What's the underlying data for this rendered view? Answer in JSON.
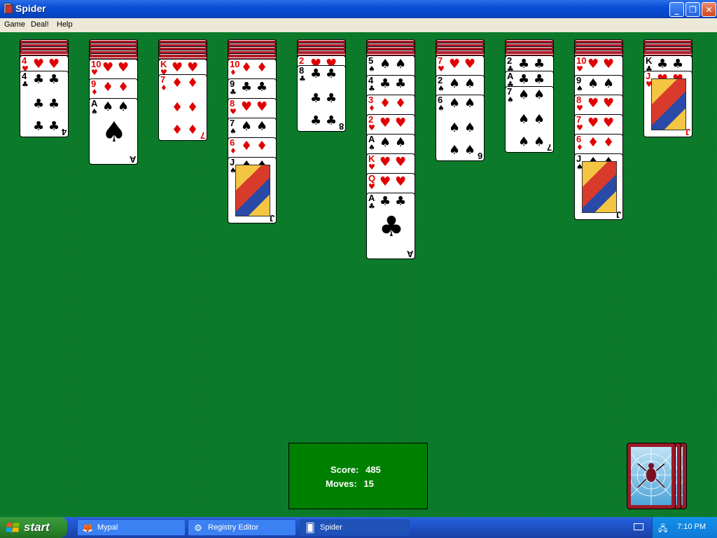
{
  "window": {
    "title": "Spider"
  },
  "menu": [
    "Game",
    "Deal!",
    "Help"
  ],
  "status": {
    "score_label": "Score:",
    "score": "485",
    "moves_label": "Moves:",
    "moves": "15"
  },
  "columns": [
    {
      "hidden": 4,
      "cards": [
        {
          "rank": "4",
          "suit": "♥"
        },
        {
          "rank": "4",
          "suit": "♣"
        }
      ]
    },
    {
      "hidden": 5,
      "cards": [
        {
          "rank": "10",
          "suit": "♥"
        },
        {
          "rank": "9",
          "suit": "♦"
        },
        {
          "rank": "A",
          "suit": "♠"
        }
      ]
    },
    {
      "hidden": 5,
      "cards": [
        {
          "rank": "K",
          "suit": "♥"
        },
        {
          "rank": "7",
          "suit": "♦"
        }
      ]
    },
    {
      "hidden": 5,
      "cards": [
        {
          "rank": "10",
          "suit": "♦"
        },
        {
          "rank": "9",
          "suit": "♣"
        },
        {
          "rank": "8",
          "suit": "♥"
        },
        {
          "rank": "7",
          "suit": "♠"
        },
        {
          "rank": "6",
          "suit": "♦"
        },
        {
          "rank": "J",
          "suit": "♠"
        }
      ]
    },
    {
      "hidden": 4,
      "cards": [
        {
          "rank": "2",
          "suit": "♥"
        },
        {
          "rank": "8",
          "suit": "♣"
        }
      ]
    },
    {
      "hidden": 4,
      "cards": [
        {
          "rank": "5",
          "suit": "♠"
        },
        {
          "rank": "4",
          "suit": "♣"
        },
        {
          "rank": "3",
          "suit": "♦"
        },
        {
          "rank": "2",
          "suit": "♥"
        },
        {
          "rank": "A",
          "suit": "♠"
        },
        {
          "rank": "K",
          "suit": "♥"
        },
        {
          "rank": "Q",
          "suit": "♥"
        },
        {
          "rank": "A",
          "suit": "♣"
        }
      ]
    },
    {
      "hidden": 4,
      "cards": [
        {
          "rank": "7",
          "suit": "♥"
        },
        {
          "rank": "2",
          "suit": "♠"
        },
        {
          "rank": "6",
          "suit": "♠"
        }
      ]
    },
    {
      "hidden": 4,
      "cards": [
        {
          "rank": "2",
          "suit": "♣"
        },
        {
          "rank": "A",
          "suit": "♣"
        },
        {
          "rank": "7",
          "suit": "♠"
        }
      ]
    },
    {
      "hidden": 4,
      "cards": [
        {
          "rank": "10",
          "suit": "♥"
        },
        {
          "rank": "9",
          "suit": "♠"
        },
        {
          "rank": "8",
          "suit": "♥"
        },
        {
          "rank": "7",
          "suit": "♥"
        },
        {
          "rank": "6",
          "suit": "♦"
        },
        {
          "rank": "J",
          "suit": "♠"
        }
      ]
    },
    {
      "hidden": 4,
      "cards": [
        {
          "rank": "K",
          "suit": "♣"
        },
        {
          "rank": "J",
          "suit": "♥"
        }
      ]
    }
  ],
  "stock_piles": 3,
  "taskbar": {
    "start_label": "start",
    "items": [
      {
        "label": "Mypal",
        "icon": "browser-icon"
      },
      {
        "label": "Registry Editor",
        "icon": "registry-icon"
      },
      {
        "label": "Spider",
        "icon": "spider-app-icon"
      }
    ],
    "clock": "7:10 PM"
  }
}
